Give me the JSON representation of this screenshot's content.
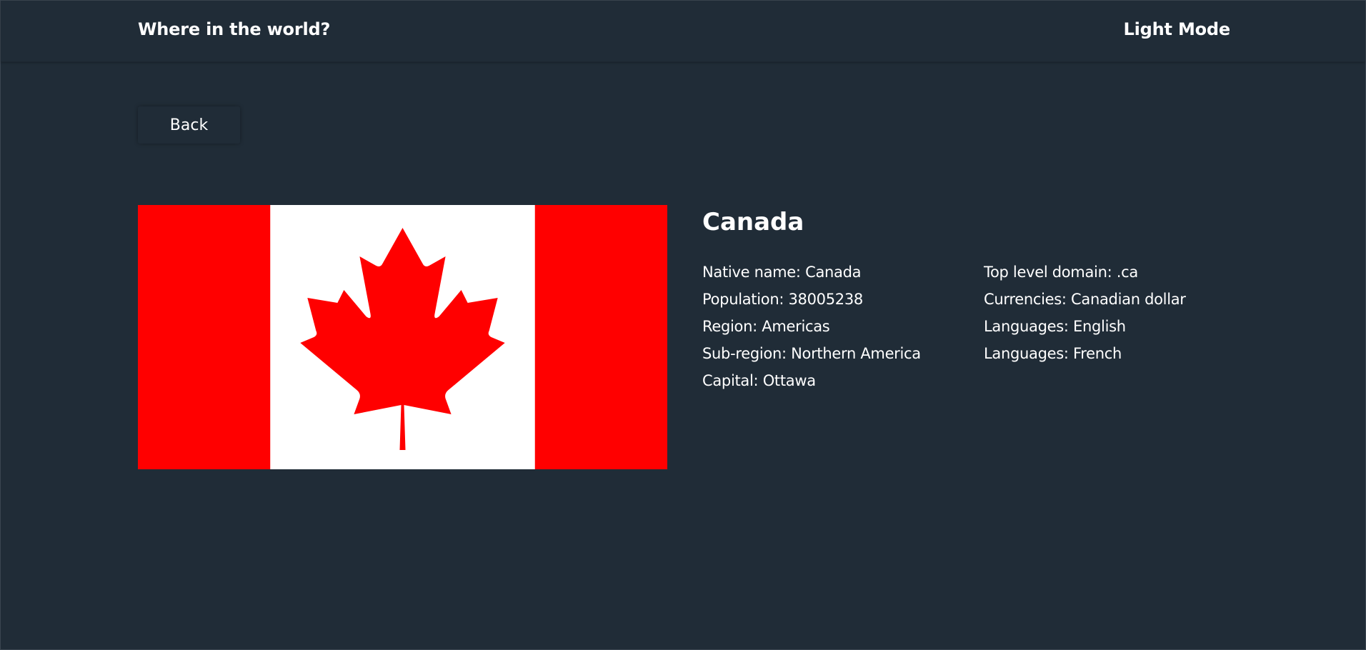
{
  "header": {
    "title": "Where in the world?",
    "mode_label": "Light Mode",
    "mode_icon": "moon-icon"
  },
  "back_button": {
    "label": "Back"
  },
  "country": {
    "name": "Canada",
    "flag_icon": "canada-flag",
    "details_left": [
      {
        "label": "Native name:",
        "value": "Canada"
      },
      {
        "label": "Population:",
        "value": "38005238"
      },
      {
        "label": "Region:",
        "value": "Americas"
      },
      {
        "label": "Sub-region:",
        "value": "Northern America"
      },
      {
        "label": "Capital:",
        "value": "Ottawa"
      }
    ],
    "details_right": [
      {
        "label": "Top level domain:",
        "value": ".ca"
      },
      {
        "label": "Currencies:",
        "value": "Canadian dollar"
      },
      {
        "label": "Languages:",
        "value": "English"
      },
      {
        "label": "Languages:",
        "value": "French"
      }
    ]
  },
  "colors": {
    "background": "#202c37",
    "text": "#ffffff",
    "flag_red": "#ff0000",
    "flag_white": "#ffffff"
  }
}
